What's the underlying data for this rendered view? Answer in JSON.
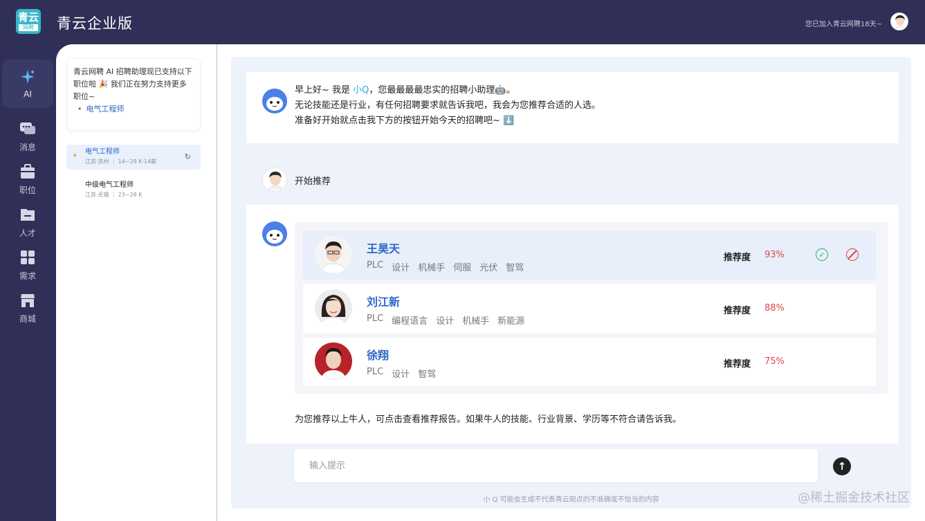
{
  "app": {
    "logo_line1": "青云",
    "logo_line2": "网聘",
    "title": "青云企业版",
    "join_text": "您已加入青云网聘18天~"
  },
  "nav": {
    "items": [
      {
        "label": "AI",
        "icon": "sparkle-icon",
        "active": true
      },
      {
        "label": "消息",
        "icon": "chat-icon"
      },
      {
        "label": "职位",
        "icon": "briefcase-icon"
      },
      {
        "label": "人才",
        "icon": "folder-icon"
      },
      {
        "label": "需求",
        "icon": "grid-icon"
      },
      {
        "label": "商城",
        "icon": "store-icon"
      }
    ]
  },
  "sidebar": {
    "notice_text": "青云网聘 AI 招聘助理现已支持以下职位啦 🎉 我们正在努力支持更多职位~",
    "notice_job": "电气工程师",
    "jobs": [
      {
        "title": "电气工程师",
        "sub": "江苏·苏州 ｜ 14~28 K·14薪"
      },
      {
        "title": "中级电气工程师",
        "sub": "江苏·无锡 ｜ 23~28 K"
      }
    ]
  },
  "chat": {
    "greet_line1_a": "早上好~ 我是 ",
    "greet_name": "小Q",
    "greet_line1_b": "，您最最最最忠实的招聘小助理🤖。",
    "greet_line2": "无论技能还是行业，有任何招聘要求就告诉我吧，我会为您推荐合适的人选。",
    "greet_line3": "准备好开始就点击我下方的按钮开始今天的招聘吧~ ⬇️",
    "user_message": "开始推荐",
    "score_label": "推荐度",
    "candidates": [
      {
        "name": "王昊天",
        "tags": [
          "PLC",
          "设计",
          "机械手",
          "伺服",
          "光伏",
          "智驾"
        ],
        "score": "93%"
      },
      {
        "name": "刘江新",
        "tags": [
          "PLC",
          "编程语言",
          "设计",
          "机械手",
          "新能源"
        ],
        "score": "88%"
      },
      {
        "name": "徐翔",
        "tags": [
          "PLC",
          "设计",
          "智驾"
        ],
        "score": "75%"
      }
    ],
    "footer": "为您推荐以上牛人，可点击查看推荐报告。如果牛人的技能、行业背景、学历等不符合请告诉我。",
    "input_placeholder": "输入提示",
    "disclaimer": "小 Q 可能会生成不代表青云观点的不准确或不恰当的内容"
  },
  "watermark": "@稀土掘金技术社区",
  "colors": {
    "header_bg": "#2f2f57",
    "accent_blue": "#2d67c8",
    "score_red": "#e0454b",
    "accept_green": "#2cb36b"
  }
}
